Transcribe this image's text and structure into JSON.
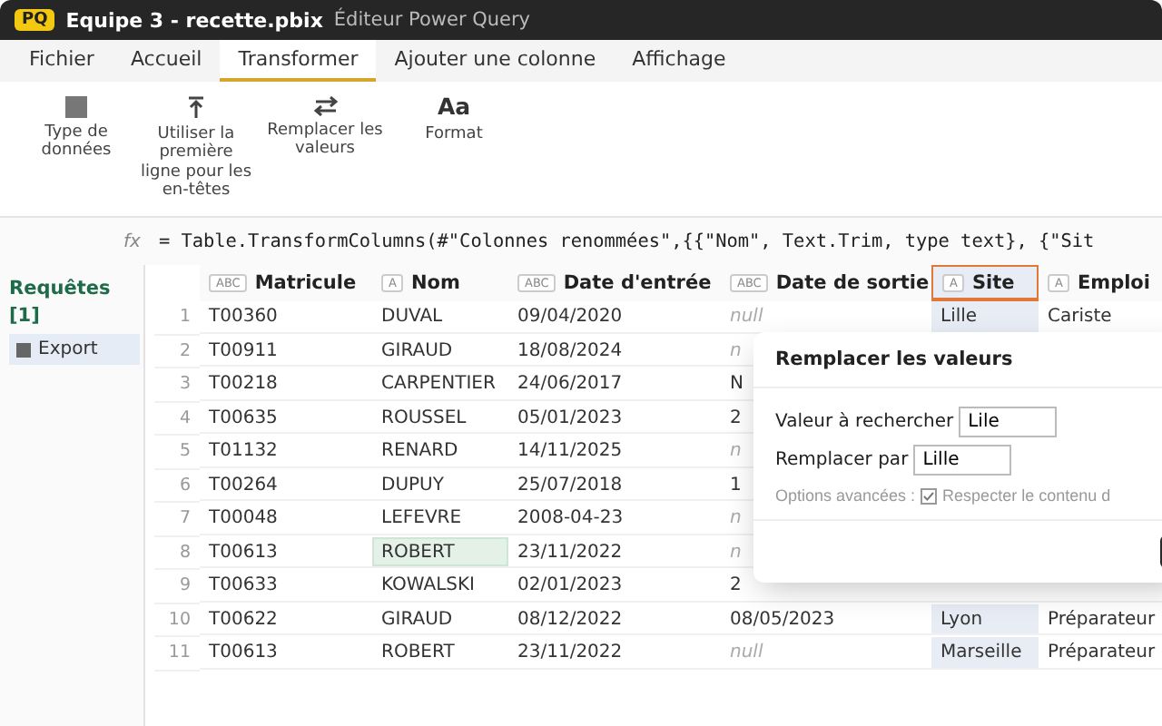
{
  "window": {
    "badge": "PQ",
    "title": "Equipe 3 - recette.pbix",
    "subtitle": "Éditeur Power Query"
  },
  "menu_tabs": [
    {
      "label": "Fichier",
      "selected": false
    },
    {
      "label": "Accueil",
      "selected": false
    },
    {
      "label": "Transformer",
      "selected": true
    },
    {
      "label": "Ajouter une colonne",
      "selected": false
    },
    {
      "label": "Affichage",
      "selected": false
    }
  ],
  "ribbon": [
    {
      "kind": "grid",
      "label": "Type de données"
    },
    {
      "kind": "header",
      "label": "Utiliser la première ligne pour les en-têtes"
    },
    {
      "kind": "swap",
      "label": "Remplacer les valeurs"
    },
    {
      "kind": "text",
      "glyph": "Aa",
      "label": "Format"
    }
  ],
  "formula_bar": {
    "label": "fx",
    "formula": "= Table.TransformColumns(#\"Colonnes renommées\",{{\"Nom\", Text.Trim, type text}, {\"Sit"
  },
  "queries": {
    "title": "Requêtes [1]",
    "items": [
      {
        "label": "Export",
        "selected": true
      }
    ]
  },
  "table": {
    "columns": [
      {
        "type_badge": "ABC",
        "name": "Matricule",
        "selected": false
      },
      {
        "type_badge": "A",
        "name": "Nom",
        "selected": false
      },
      {
        "type_badge": "ABC",
        "name": "Date d'entrée",
        "selected": false
      },
      {
        "type_badge": "ABC",
        "name": "Date de sortie",
        "selected": false
      },
      {
        "type_badge": "A",
        "name": "Site",
        "selected": true
      },
      {
        "type_badge": "A",
        "name": "Emploi",
        "selected": false
      }
    ],
    "rows": [
      {
        "number": "1",
        "cells": [
          {
            "text": "T00360",
            "null": false,
            "selected": false
          },
          {
            "text": "DUVAL",
            "null": false,
            "selected": false
          },
          {
            "text": "09/04/2020",
            "null": false,
            "selected": false
          },
          {
            "text": "null",
            "null": true,
            "selected": false
          },
          {
            "text": "Lille",
            "null": false,
            "selected": false
          },
          {
            "text": "Cariste",
            "null": false,
            "selected": false
          }
        ]
      },
      {
        "number": "2",
        "cells": [
          {
            "text": "T00911",
            "null": false,
            "selected": false
          },
          {
            "text": "GIRAUD",
            "null": false,
            "selected": false
          },
          {
            "text": "18/08/2024",
            "null": false,
            "selected": false
          },
          {
            "text": "n",
            "null": true,
            "selected": false
          }
        ]
      },
      {
        "number": "3",
        "cells": [
          {
            "text": "T00218",
            "null": false,
            "selected": false
          },
          {
            "text": "CARPENTIER",
            "null": false,
            "selected": false
          },
          {
            "text": "24/06/2017",
            "null": false,
            "selected": false
          },
          {
            "text": "N",
            "null": false,
            "selected": false
          }
        ]
      },
      {
        "number": "4",
        "cells": [
          {
            "text": "T00635",
            "null": false,
            "selected": false
          },
          {
            "text": "ROUSSEL",
            "null": false,
            "selected": false
          },
          {
            "text": "05/01/2023",
            "null": false,
            "selected": false
          },
          {
            "text": "2",
            "null": false,
            "selected": false
          }
        ]
      },
      {
        "number": "5",
        "cells": [
          {
            "text": "T01132",
            "null": false,
            "selected": false
          },
          {
            "text": "RENARD",
            "null": false,
            "selected": false
          },
          {
            "text": "14/11/2025",
            "null": false,
            "selected": false
          },
          {
            "text": "n",
            "null": true,
            "selected": false
          }
        ]
      },
      {
        "number": "6",
        "cells": [
          {
            "text": "T00264",
            "null": false,
            "selected": false
          },
          {
            "text": "DUPUY",
            "null": false,
            "selected": false
          },
          {
            "text": "25/07/2018",
            "null": false,
            "selected": false
          },
          {
            "text": "1",
            "null": false,
            "selected": false
          }
        ]
      },
      {
        "number": "7",
        "cells": [
          {
            "text": "T00048",
            "null": false,
            "selected": false
          },
          {
            "text": "LEFEVRE",
            "null": false,
            "selected": false
          },
          {
            "text": "2008-04-23",
            "null": false,
            "selected": false
          },
          {
            "text": "n",
            "null": true,
            "selected": false
          }
        ]
      },
      {
        "number": "8",
        "cells": [
          {
            "text": "T00613",
            "null": false,
            "selected": false
          },
          {
            "text": "ROBERT",
            "null": false,
            "selected": true
          },
          {
            "text": "23/11/2022",
            "null": false,
            "selected": false
          },
          {
            "text": "n",
            "null": true,
            "selected": false
          }
        ]
      },
      {
        "number": "9",
        "cells": [
          {
            "text": "T00633",
            "null": false,
            "selected": false
          },
          {
            "text": "KOWALSKI",
            "null": false,
            "selected": false
          },
          {
            "text": "02/01/2023",
            "null": false,
            "selected": false
          },
          {
            "text": "2",
            "null": false,
            "selected": false
          }
        ]
      },
      {
        "number": "10",
        "cells": [
          {
            "text": "T00622",
            "null": false,
            "selected": false
          },
          {
            "text": "GIRAUD",
            "null": false,
            "selected": false
          },
          {
            "text": "08/12/2022",
            "null": false,
            "selected": false
          },
          {
            "text": "08/05/2023",
            "null": false,
            "selected": false
          },
          {
            "text": "Lyon",
            "null": false,
            "selected": false
          },
          {
            "text": "Préparateur",
            "null": false,
            "selected": false
          }
        ]
      },
      {
        "number": "11",
        "cells": [
          {
            "text": "T00613",
            "null": false,
            "selected": false
          },
          {
            "text": "ROBERT",
            "null": false,
            "selected": false
          },
          {
            "text": "23/11/2022",
            "null": false,
            "selected": false
          },
          {
            "text": "null",
            "null": true,
            "selected": false
          },
          {
            "text": "Marseille",
            "null": false,
            "selected": false
          },
          {
            "text": "Préparateur",
            "null": false,
            "selected": false
          }
        ]
      }
    ]
  },
  "dialog": {
    "title": "Remplacer les valeurs",
    "fields": [
      {
        "label": "Valeur à rechercher",
        "value": "Lile"
      },
      {
        "label": "Remplacer par",
        "value": "Lille"
      }
    ],
    "options_label": "Options avancées :",
    "option": {
      "label": "Respecter le contenu d",
      "checked": true
    }
  }
}
